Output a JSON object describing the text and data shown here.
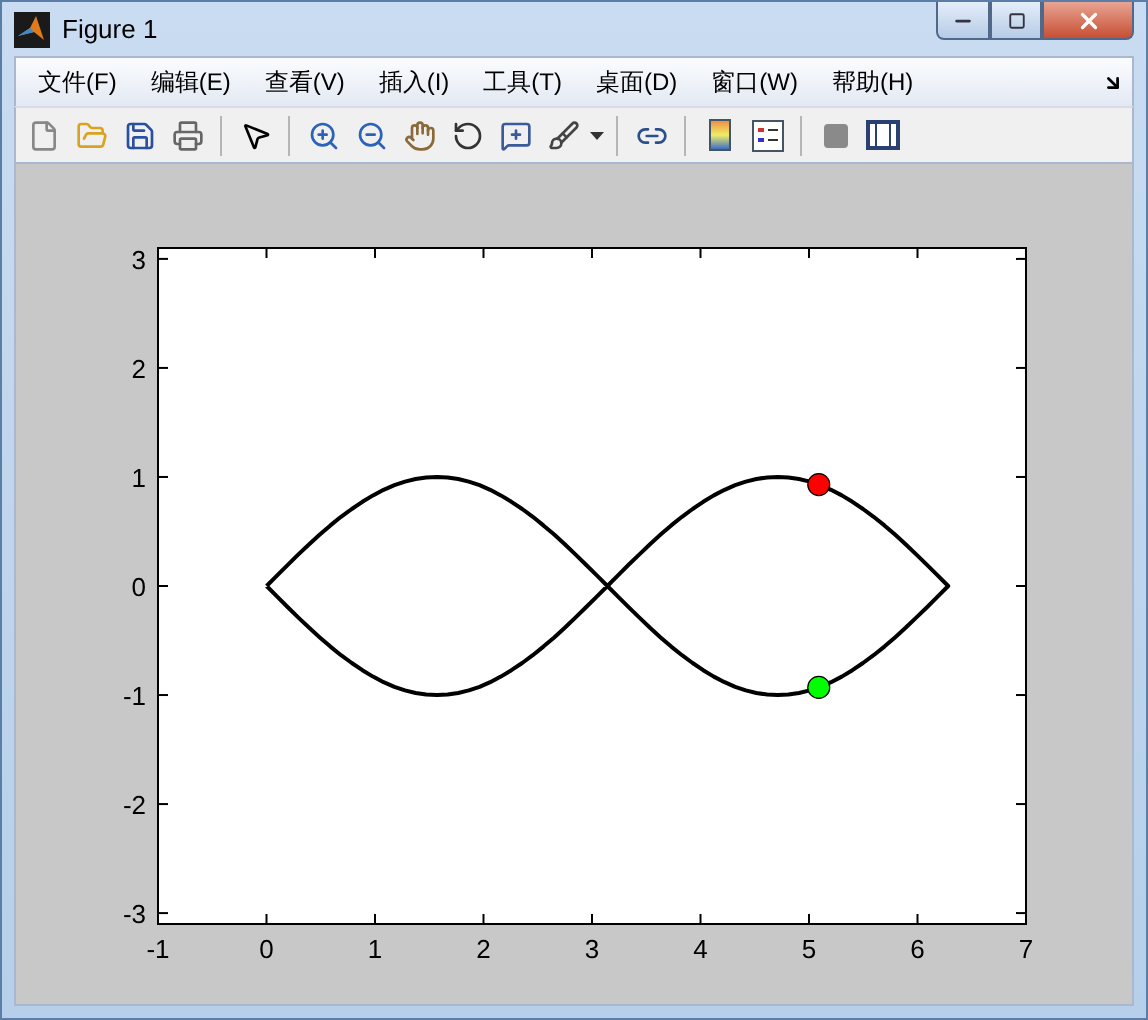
{
  "window": {
    "title": "Figure 1"
  },
  "menu": [
    "文件(F)",
    "编辑(E)",
    "查看(V)",
    "插入(I)",
    "工具(T)",
    "桌面(D)",
    "窗口(W)",
    "帮助(H)"
  ],
  "figure": {
    "chart_data": {
      "type": "scatter",
      "x": [
        5.09
      ],
      "series": [
        {
          "color": "#ff0000",
          "values": [
            0.93
          ]
        },
        {
          "color": "#00ff00",
          "values": [
            -0.93
          ]
        }
      ],
      "xlim": [
        -1,
        7
      ],
      "ylim": [
        -3.1,
        3.1
      ],
      "xticks": [
        -1,
        0,
        1,
        2,
        3,
        4,
        5,
        6,
        7
      ],
      "yticks": [
        -3,
        -2,
        -1,
        0,
        1,
        2,
        3
      ]
    }
  }
}
